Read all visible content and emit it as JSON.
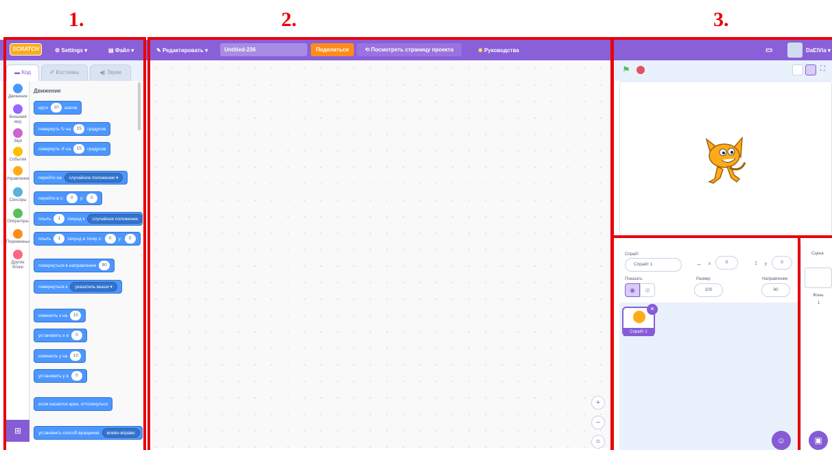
{
  "section_labels": [
    "1.",
    "2.",
    "3."
  ],
  "menubar": {
    "logo": "SCRATCH",
    "settings": "Settings ▾",
    "file": "Файл ▾",
    "edit": "Редактировать ▾",
    "project_title": "Untitled-236",
    "share": "Поделиться",
    "see_project_page": "Посмотреть страницу проекта",
    "tutorials": "Руководства",
    "username": "DaElVia ▾"
  },
  "tabs": [
    "Код",
    "Костюмы",
    "Звуки"
  ],
  "categories": [
    {
      "label": "Движение",
      "color": "#4c97ff"
    },
    {
      "label": "Внешний вид",
      "color": "#9966ff"
    },
    {
      "label": "Звук",
      "color": "#cf63cf"
    },
    {
      "label": "События",
      "color": "#ffbf00"
    },
    {
      "label": "Управление",
      "color": "#ffab19"
    },
    {
      "label": "Сенсоры",
      "color": "#5cb1d6"
    },
    {
      "label": "Операторы",
      "color": "#59c059"
    },
    {
      "label": "Переменные",
      "color": "#ff8c1a"
    },
    {
      "label": "Другие блоки",
      "color": "#ff6680"
    }
  ],
  "palette": {
    "heading": "Движение",
    "blocks": {
      "move": {
        "a": "идти",
        "n": "10",
        "b": "шагов"
      },
      "turn_right": {
        "a": "повернуть ↻ на",
        "n": "15",
        "b": "градусов"
      },
      "turn_left": {
        "a": "повернуть ↺ на",
        "n": "15",
        "b": "градусов"
      },
      "goto": {
        "a": "перейти на",
        "dd": "случайное положение ▾"
      },
      "goto_xy": {
        "a": "перейти в x:",
        "x": "0",
        "b": "y:",
        "y": "0"
      },
      "glide_to": {
        "a": "плыть",
        "n": "1",
        "b": "секунд к",
        "dd": "случайное положение"
      },
      "glide_xy": {
        "a": "плыть",
        "n": "1",
        "b": "секунд в точку x:",
        "x": "0",
        "c": "y:",
        "y": "0"
      },
      "point_dir": {
        "a": "повернуться в направлении",
        "n": "90"
      },
      "point_towards": {
        "a": "повернуться к",
        "dd": "указатель мыши ▾"
      },
      "change_x": {
        "a": "изменить x на",
        "n": "10"
      },
      "set_x": {
        "a": "установить x в",
        "n": "0"
      },
      "change_y": {
        "a": "изменить y на",
        "n": "10"
      },
      "set_y": {
        "a": "установить y в",
        "n": "0"
      },
      "bounce": {
        "a": "если касается края, оттолкнуться"
      },
      "rotation_style": {
        "a": "установить способ вращения",
        "dd": "влево-вправо"
      }
    }
  },
  "zoom": {
    "in": "+",
    "out": "−",
    "reset": "="
  },
  "sprite_info": {
    "sprite_label": "Спрайт",
    "sprite_name": "Спрайт 1",
    "x_label": "x",
    "x_value": "0",
    "y_label": "y",
    "y_value": "0",
    "show_label": "Показать",
    "size_label": "Размер",
    "size_value": "100",
    "direction_label": "Направление",
    "direction_value": "90"
  },
  "sprite_tile": {
    "name": "Спрайт 1"
  },
  "stage_panel": {
    "title": "Сцена",
    "backdrops_label": "Фоны",
    "backdrops_count": "1"
  }
}
